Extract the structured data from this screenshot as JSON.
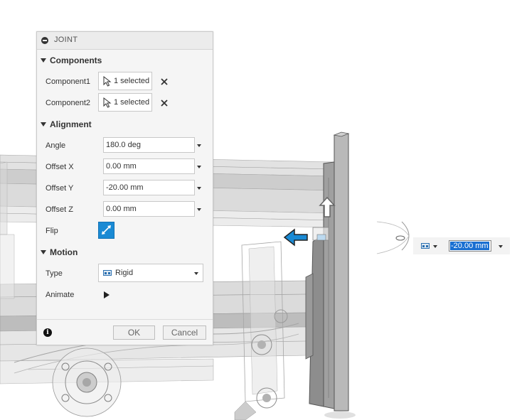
{
  "dialog": {
    "title": "JOINT",
    "sections": {
      "components": "Components",
      "alignment": "Alignment",
      "motion": "Motion"
    },
    "components": [
      {
        "label": "Component1",
        "value": "1 selected"
      },
      {
        "label": "Component2",
        "value": "1 selected"
      }
    ],
    "alignment": {
      "angle": {
        "label": "Angle",
        "value": "180.0 deg"
      },
      "offset_x": {
        "label": "Offset X",
        "value": "0.00 mm"
      },
      "offset_y": {
        "label": "Offset Y",
        "value": "-20.00 mm"
      },
      "offset_z": {
        "label": "Offset Z",
        "value": "0.00 mm"
      },
      "flip": {
        "label": "Flip"
      }
    },
    "motion": {
      "type": {
        "label": "Type",
        "value": "Rigid"
      },
      "animate": {
        "label": "Animate"
      }
    },
    "ok_label": "OK",
    "cancel_label": "Cancel"
  },
  "float_input": {
    "value": "-20.00 mm"
  },
  "icons": {
    "dialog_header": "minimize-icon",
    "select_cursor": "cursor-select-icon",
    "remove": "close-icon",
    "flip": "flip-arrows-icon",
    "joint_type": "rigid-joint-icon",
    "animate": "play-icon",
    "info": "info-icon",
    "move_up": "arrow-up-icon",
    "move_left": "arrow-left-icon"
  },
  "colors": {
    "accent": "#1a8ad4",
    "selection": "#1a6fd1",
    "manipulator": "#1a8ad4"
  }
}
